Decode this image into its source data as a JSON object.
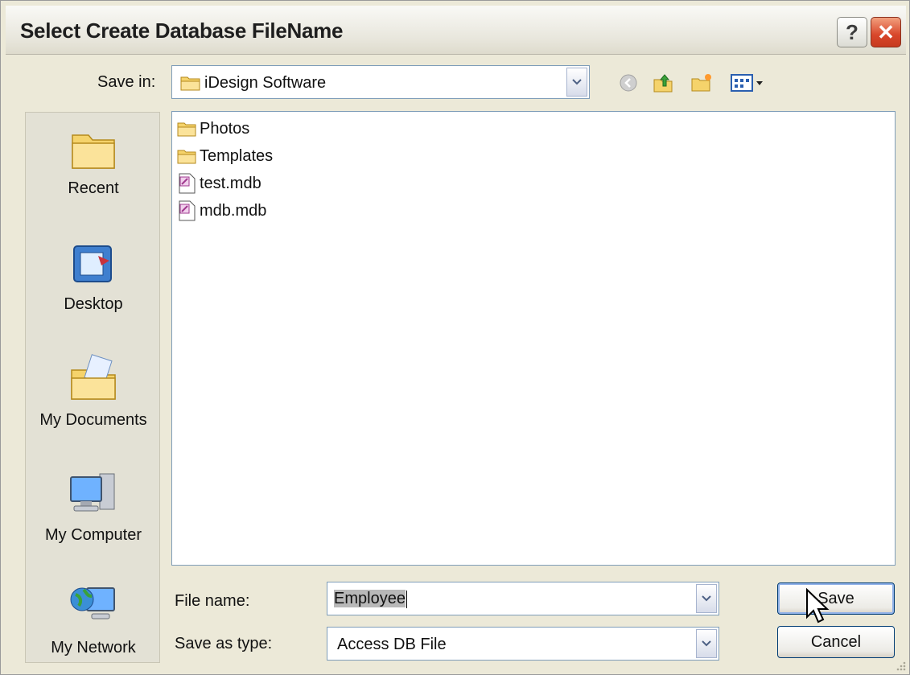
{
  "window": {
    "title": "Select Create Database FileName",
    "help_label": "?",
    "close_label": "✕"
  },
  "toolbar": {
    "save_in_label": "Save in:",
    "save_in_value": "iDesign Software",
    "icons": [
      "back-icon",
      "up-folder-icon",
      "new-folder-icon",
      "view-menu-icon"
    ]
  },
  "places": [
    {
      "label": "Recent",
      "icon": "recent-folder-icon"
    },
    {
      "label": "Desktop",
      "icon": "desktop-icon"
    },
    {
      "label": "My Documents",
      "icon": "my-documents-icon"
    },
    {
      "label": "My Computer",
      "icon": "my-computer-icon"
    },
    {
      "label": "My Network",
      "icon": "my-network-icon"
    }
  ],
  "files": [
    {
      "name": "Photos",
      "type": "folder"
    },
    {
      "name": "Templates",
      "type": "folder"
    },
    {
      "name": "test.mdb",
      "type": "mdb"
    },
    {
      "name": "mdb.mdb",
      "type": "mdb"
    }
  ],
  "form": {
    "file_name_label": "File name:",
    "file_name_value": "Employee",
    "save_as_type_label": "Save as type:",
    "save_as_type_value": "Access DB File"
  },
  "buttons": {
    "save": "Save",
    "cancel": "Cancel"
  },
  "colors": {
    "accent": "#003c74",
    "close": "#d8462a",
    "folder": "#f5d36b"
  }
}
